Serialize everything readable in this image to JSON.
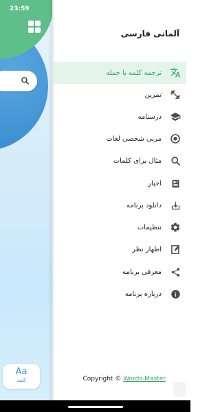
{
  "status_bar": {
    "time": "23:59"
  },
  "background": {
    "card_icon_text": "Aa",
    "card_label": "کلمه"
  },
  "drawer": {
    "title": "آلمانی فارسی",
    "items": [
      {
        "label": "ترجمه کلمه یا جمله",
        "icon": "translate-icon",
        "active": true
      },
      {
        "label": "تمرین",
        "icon": "dumbbell-icon",
        "active": false
      },
      {
        "label": "درسنامه",
        "icon": "graduation-cap-icon",
        "active": false
      },
      {
        "label": "مربی شخصی لغات",
        "icon": "coach-icon",
        "active": false
      },
      {
        "label": "مثال برای کلمات",
        "icon": "search-icon",
        "active": false
      },
      {
        "label": "اخبار",
        "icon": "news-icon",
        "active": false
      },
      {
        "label": "دانلود برنامه",
        "icon": "download-icon",
        "active": false
      },
      {
        "label": "تنظیمات",
        "icon": "gear-icon",
        "active": false
      },
      {
        "label": "اظهار نظر",
        "icon": "feedback-icon",
        "active": false
      },
      {
        "label": "معرفی برنامه",
        "icon": "share-icon",
        "active": false
      },
      {
        "label": "درباره برنامه",
        "icon": "info-icon",
        "active": false
      }
    ],
    "copyright": {
      "prefix": "Copyright © ",
      "link": "Words-Master"
    }
  },
  "colors": {
    "accent": "#3aa863",
    "active_bg": "#e4f4ea",
    "icon_gray": "#4a4a4a",
    "header_green": "#5fbf8a",
    "blue": "#3b8fd8"
  }
}
